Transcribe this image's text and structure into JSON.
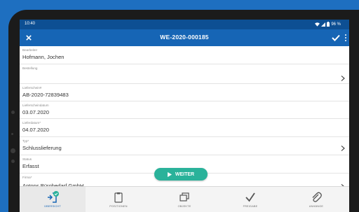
{
  "statusbar": {
    "time": "10:40",
    "battery": "96 %"
  },
  "appbar": {
    "title": "WE-2020-000185"
  },
  "fields": [
    {
      "label": "Bearbeiter",
      "value": "Hofmann, Jochen",
      "chevron": false
    },
    {
      "label": "Bestellung",
      "value": "",
      "chevron": true
    },
    {
      "label": "Lieferschein#",
      "value": "AB-2020-72839483",
      "chevron": false
    },
    {
      "label": "Lieferscheindatum",
      "value": "03.07.2020",
      "chevron": false
    },
    {
      "label": "Lieferdatum*",
      "value": "04.07.2020",
      "chevron": false
    },
    {
      "label": "Typ*",
      "value": "Schlusslieferung",
      "chevron": true
    },
    {
      "label": "Status",
      "value": "Erfasst",
      "chevron": false
    },
    {
      "label": "Firma*",
      "value": "Antons Bürobedarf GmbH",
      "chevron": true
    }
  ],
  "weiter_button": {
    "label": "WEITER"
  },
  "bottom_nav": [
    {
      "label": "ÜBERSICHT",
      "icon": "overview-check-icon",
      "active": true
    },
    {
      "label": "POSITIONEN",
      "icon": "clipboard-icon",
      "active": false
    },
    {
      "label": "OBJEKTE",
      "icon": "objects-stack-icon",
      "active": false
    },
    {
      "label": "FREIGABE",
      "icon": "approval-check-icon",
      "active": false
    },
    {
      "label": "ANHÄNGE",
      "icon": "paperclip-icon",
      "active": false
    }
  ],
  "colors": {
    "appbar": "#1665b5",
    "statusbar": "#0d4f93",
    "accent_button": "#2ab29a",
    "active_nav": "#1665b5",
    "background": "#1e6fc0"
  }
}
